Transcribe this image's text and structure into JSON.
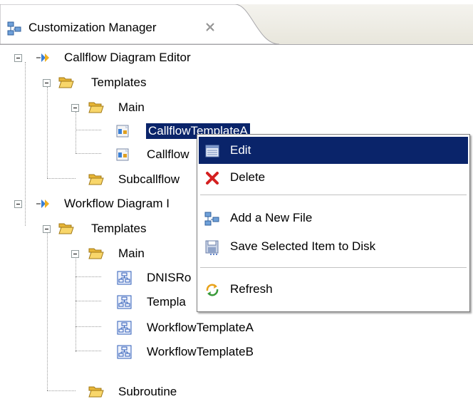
{
  "tab": {
    "title": "Customization Manager",
    "icons": {
      "view": "customization-manager-icon",
      "close": "close-icon"
    }
  },
  "tree": {
    "callflow_editor": "Callflow Diagram Editor",
    "callflow_templates": "Templates",
    "callflow_main": "Main",
    "callflow_template_a": "CallflowTemplateA",
    "callflow_template_b": "Callflow",
    "subcallflow": "Subcallflow",
    "workflow_editor": "Workflow Diagram I",
    "workflow_templates": "Templates",
    "workflow_main": "Main",
    "dnis": "DNISRo",
    "templa": "Templa",
    "workflow_template_a": "WorkflowTemplateA",
    "workflow_template_b": "WorkflowTemplateB",
    "subroutine": "Subroutine"
  },
  "context_menu": {
    "edit": "Edit",
    "delete": "Delete",
    "add_new_file": "Add a New File",
    "save_to_disk": "Save Selected Item to Disk",
    "refresh": "Refresh"
  },
  "colors": {
    "selection": "#0a246a",
    "folder": "#f5c94a",
    "tab_bg": "#e8e6dc",
    "delete_red": "#d42020"
  }
}
